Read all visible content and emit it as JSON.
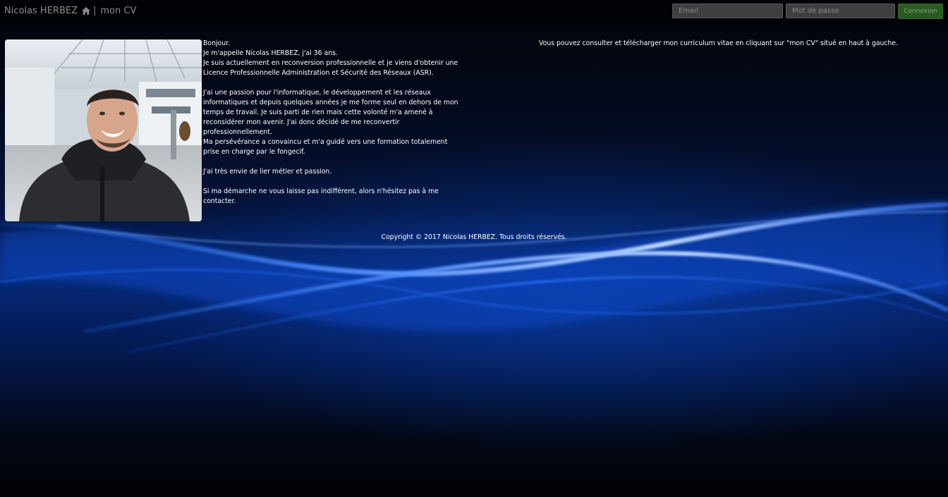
{
  "header": {
    "brand": "Nicolas HERBEZ",
    "home_icon": "home-icon",
    "separator": "|",
    "cv_link": "mon CV",
    "email_placeholder": "Email",
    "password_placeholder": "Mot de passe",
    "login_label": "Connexion"
  },
  "intro": {
    "greeting": "Bonjour.",
    "line_name": "Je m'appelle Nicolas HERBEZ, j'ai 36 ans.",
    "line_reconversion": "Je suis actuellement en reconversion professionnelle et je viens d'obtenir une Licence Professionnelle Administration et Sécurité des Réseaux (ASR).",
    "paragraph_passion": "J'ai une passion pour l'informatique, le développement et les réseaux informatiques et depuis quelques années je me forme seul en dehors de mon temps de travail. Je suis parti de rien mais cette volonté m'a amené à reconsidérer mon avenir. J'ai donc décidé de me reconvertir professionnellement.",
    "line_perseverance": "Ma persévérance a convaincu et m'a guidé vers une formation totalement prise en charge par le fongecif.",
    "line_desire": "J'ai très envie de lier métier et passion.",
    "line_contact": "Si ma démarche ne vous laisse pas indifférent, alors n'hésitez pas à me contacter."
  },
  "cv_note": "Vous pouvez consulter et télécharger mon curriculum vitae en cliquant sur \"mon CV\" situé en haut à gauche.",
  "footer": {
    "copyright": "Copyright © 2017 Nicolas HERBEZ. Tous droits réservés."
  },
  "colors": {
    "login_button": "#2b5a22",
    "background_wave": "#0a4fd0"
  }
}
